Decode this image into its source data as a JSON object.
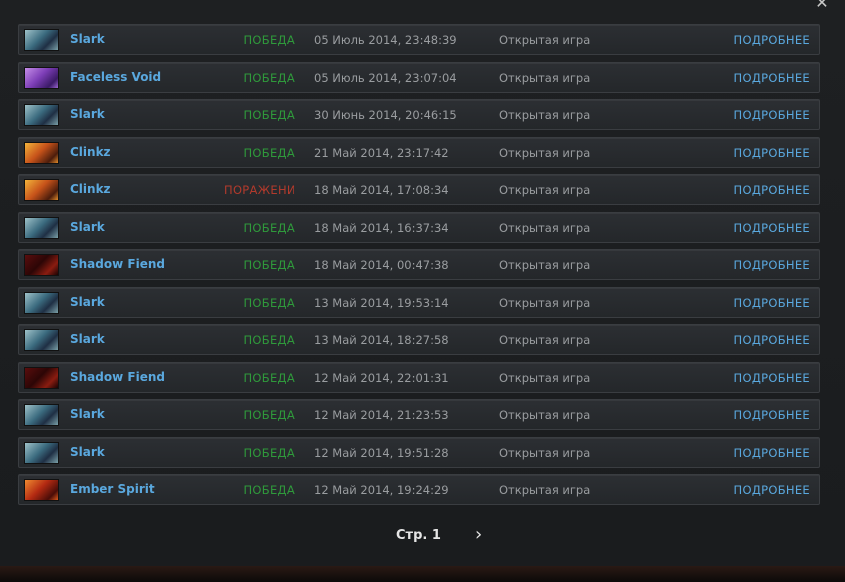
{
  "window": {
    "close_glyph": "✕"
  },
  "matches": [
    {
      "hero": "Slark",
      "icon": "av-slark",
      "result": "ПОБЕДА",
      "result_type": "win",
      "date": "05 Июль 2014, 23:48:39",
      "mode": "Открытая игра",
      "details": "ПОДРОБНЕЕ"
    },
    {
      "hero": "Faceless Void",
      "icon": "av-void",
      "result": "ПОБЕДА",
      "result_type": "win",
      "date": "05 Июль 2014, 23:07:04",
      "mode": "Открытая игра",
      "details": "ПОДРОБНЕЕ"
    },
    {
      "hero": "Slark",
      "icon": "av-slark",
      "result": "ПОБЕДА",
      "result_type": "win",
      "date": "30 Июнь 2014, 20:46:15",
      "mode": "Открытая игра",
      "details": "ПОДРОБНЕЕ"
    },
    {
      "hero": "Clinkz",
      "icon": "av-clinkz",
      "result": "ПОБЕДА",
      "result_type": "win",
      "date": "21 Май 2014, 23:17:42",
      "mode": "Открытая игра",
      "details": "ПОДРОБНЕЕ"
    },
    {
      "hero": "Clinkz",
      "icon": "av-clinkz",
      "result": "ПОРАЖЕНИ",
      "result_type": "loss",
      "date": "18 Май 2014, 17:08:34",
      "mode": "Открытая игра",
      "details": "ПОДРОБНЕЕ"
    },
    {
      "hero": "Slark",
      "icon": "av-slark",
      "result": "ПОБЕДА",
      "result_type": "win",
      "date": "18 Май 2014, 16:37:34",
      "mode": "Открытая игра",
      "details": "ПОДРОБНЕЕ"
    },
    {
      "hero": "Shadow Fiend",
      "icon": "av-sf",
      "result": "ПОБЕДА",
      "result_type": "win",
      "date": "18 Май 2014, 00:47:38",
      "mode": "Открытая игра",
      "details": "ПОДРОБНЕЕ"
    },
    {
      "hero": "Slark",
      "icon": "av-slark",
      "result": "ПОБЕДА",
      "result_type": "win",
      "date": "13 Май 2014, 19:53:14",
      "mode": "Открытая игра",
      "details": "ПОДРОБНЕЕ"
    },
    {
      "hero": "Slark",
      "icon": "av-slark",
      "result": "ПОБЕДА",
      "result_type": "win",
      "date": "13 Май 2014, 18:27:58",
      "mode": "Открытая игра",
      "details": "ПОДРОБНЕЕ"
    },
    {
      "hero": "Shadow Fiend",
      "icon": "av-sf",
      "result": "ПОБЕДА",
      "result_type": "win",
      "date": "12 Май 2014, 22:01:31",
      "mode": "Открытая игра",
      "details": "ПОДРОБНЕЕ"
    },
    {
      "hero": "Slark",
      "icon": "av-slark",
      "result": "ПОБЕДА",
      "result_type": "win",
      "date": "12 Май 2014, 21:23:53",
      "mode": "Открытая игра",
      "details": "ПОДРОБНЕЕ"
    },
    {
      "hero": "Slark",
      "icon": "av-slark",
      "result": "ПОБЕДА",
      "result_type": "win",
      "date": "12 Май 2014, 19:51:28",
      "mode": "Открытая игра",
      "details": "ПОДРОБНЕЕ"
    },
    {
      "hero": "Ember Spirit",
      "icon": "av-ember",
      "result": "ПОБЕДА",
      "result_type": "win",
      "date": "12 Май 2014, 19:24:29",
      "mode": "Открытая игра",
      "details": "ПОДРОБНЕЕ"
    }
  ],
  "pagination": {
    "label": "Стр. 1",
    "next_glyph": "›"
  }
}
